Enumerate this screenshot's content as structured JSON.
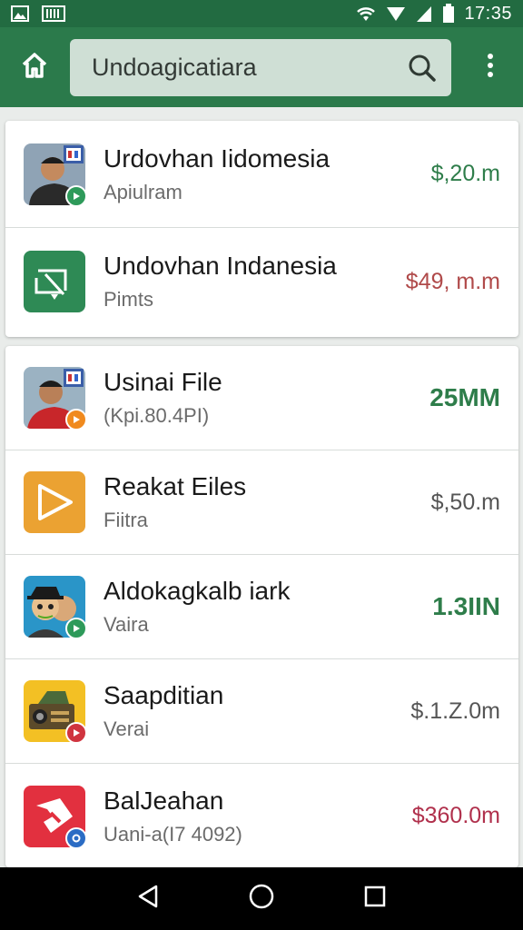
{
  "status_bar": {
    "time": "17:35",
    "icons": [
      "image-icon",
      "barcode-icon",
      "wifi-icon",
      "signal-icon",
      "battery-icon"
    ]
  },
  "app_bar": {
    "home_icon": "home-icon",
    "search": {
      "value": "Undoagicatiara",
      "icon": "search-icon"
    },
    "menu_icon": "more-vert-icon",
    "color": "#2b7a4b"
  },
  "groups": [
    {
      "items": [
        {
          "title": "Urdovhan Iidomesia",
          "subtitle": "Apiulram",
          "amount": "$,20.m",
          "amount_color": "#2e7d4a",
          "icon": "person-photo-icon",
          "badge_icon": "play-badge-icon",
          "badge_color": "#2e9a5a"
        },
        {
          "title": "Undovhan Indanesia",
          "subtitle": "Pimts",
          "amount": "$49, m.m",
          "amount_color": "#b04a4a",
          "icon": "screen-cast-app-icon",
          "badge_icon": "",
          "badge_color": ""
        }
      ]
    },
    {
      "items": [
        {
          "title": "Usinai File",
          "subtitle": "(Kpi.80.4PI)",
          "amount": "25MM",
          "amount_color": "#2e7d4a",
          "icon": "person-photo-icon",
          "badge_icon": "play-badge-icon",
          "badge_color": "#f08a1e"
        },
        {
          "title": "Reakat Eiles",
          "subtitle": "Fiitra",
          "amount": "$,50.m",
          "amount_color": "#555555",
          "icon": "play-app-icon",
          "badge_icon": "",
          "badge_color": ""
        },
        {
          "title": "Aldokagkalb iark",
          "subtitle": "Vaira",
          "amount": "1.3IIN",
          "amount_color": "#2e7d4a",
          "icon": "cartoon-avatar-icon",
          "badge_icon": "play-badge-icon",
          "badge_color": "#2e9a5a"
        },
        {
          "title": "Saapditian",
          "subtitle": "Verai",
          "amount": "$.1.Z.0m",
          "amount_color": "#555555",
          "icon": "radio-app-icon",
          "badge_icon": "play-badge-icon",
          "badge_color": "#d0343f"
        },
        {
          "title": "BalJeahan",
          "subtitle": "Uani-a(I7 4092)",
          "amount": "$360.0m",
          "amount_color": "#b0304c",
          "icon": "red-app-icon",
          "badge_icon": "circle-badge-icon",
          "badge_color": "#2b6cc4"
        }
      ]
    }
  ],
  "nav_bar": {
    "icons": [
      "back-icon",
      "home-circle-icon",
      "recents-icon"
    ]
  }
}
